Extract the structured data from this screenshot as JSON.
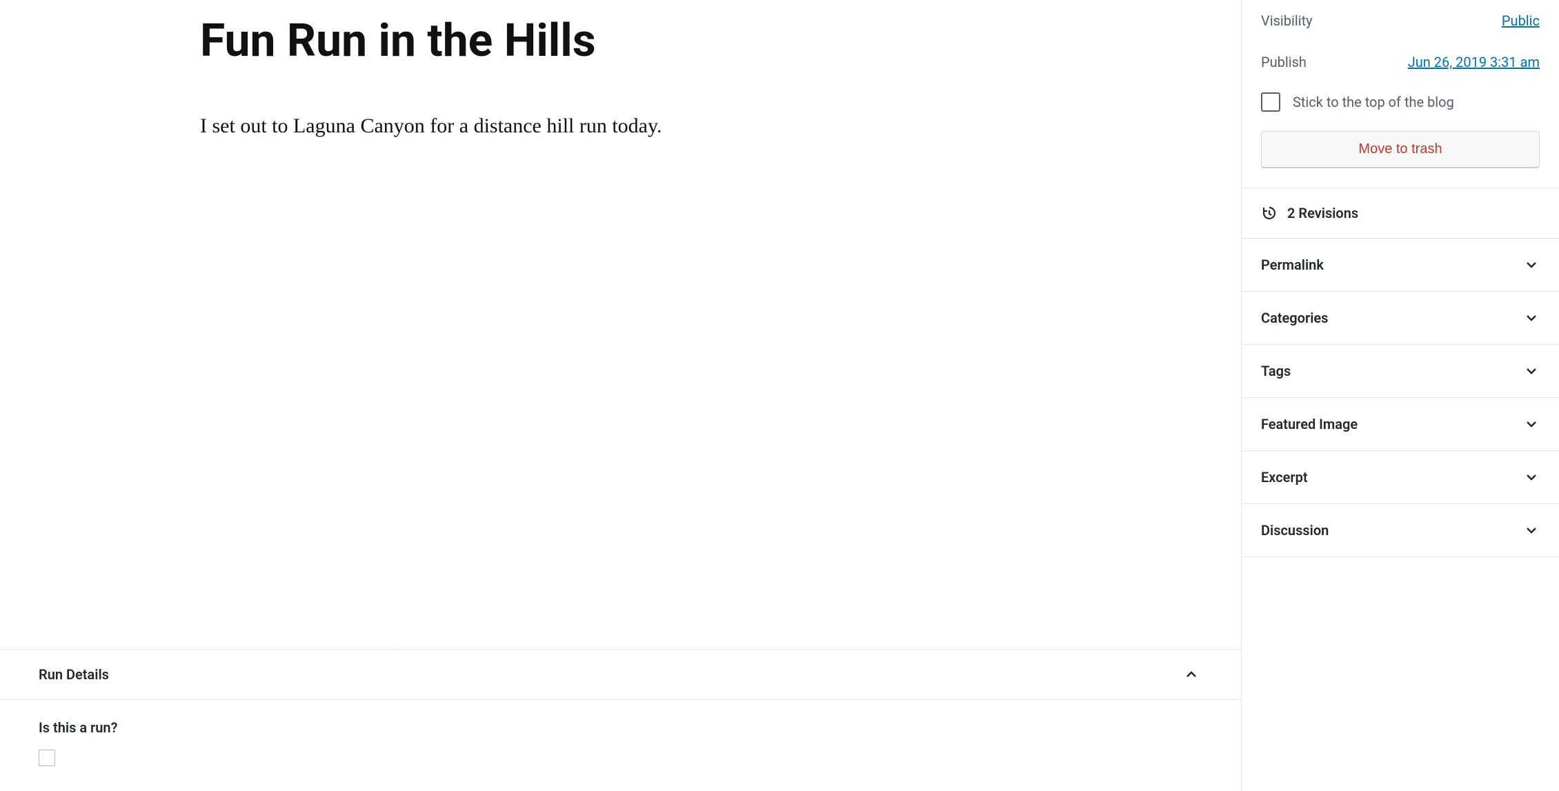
{
  "post": {
    "title": "Fun Run in the Hills",
    "body": "I set out to Laguna Canyon for a distance hill run today."
  },
  "metabox": {
    "title": "Run Details",
    "question": "Is this a run?"
  },
  "sidebar": {
    "visibility_label": "Visibility",
    "visibility_value": "Public",
    "publish_label": "Publish",
    "publish_value": "Jun 26, 2019 3:31 am",
    "sticky_label": "Stick to the top of the blog",
    "trash_label": "Move to trash",
    "revisions_label": "2 Revisions",
    "panels": [
      "Permalink",
      "Categories",
      "Tags",
      "Featured Image",
      "Excerpt",
      "Discussion"
    ]
  }
}
